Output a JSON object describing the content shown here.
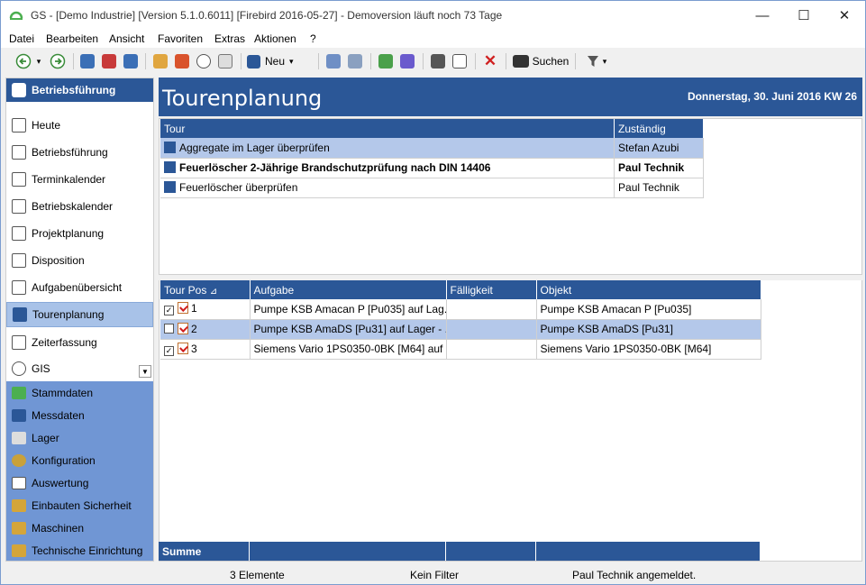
{
  "window": {
    "title": "GS - [Demo Industrie]  [Version  5.1.0.6011]  [Firebird 2016-05-27] - Demoversion läuft noch 73 Tage",
    "minimize": "—",
    "maximize": "☐",
    "close": "✕"
  },
  "menu": [
    "Datei",
    "Bearbeiten",
    "Ansicht",
    "Favoriten",
    "Extras",
    "Aktionen",
    "?"
  ],
  "toolbar": {
    "new_label": "Neu",
    "search_label": "Suchen",
    "dropdown_arrow": "▾"
  },
  "sidebar": {
    "header": "Betriebsführung",
    "items": [
      {
        "label": "Heute",
        "icon": "today-clock-icon"
      },
      {
        "label": "Betriebsführung",
        "icon": "checklist-icon"
      },
      {
        "label": "Terminkalender",
        "icon": "calendar-23-icon"
      },
      {
        "label": "Betriebskalender",
        "icon": "calendar-grid-icon"
      },
      {
        "label": "Projektplanung",
        "icon": "project-plan-icon"
      },
      {
        "label": "Disposition",
        "icon": "disposition-icon"
      },
      {
        "label": "Aufgabenübersicht",
        "icon": "task-overview-icon"
      },
      {
        "label": "Tourenplanung",
        "icon": "road-icon",
        "selected": true
      },
      {
        "label": "Zeiterfassung",
        "icon": "time-tracking-icon"
      },
      {
        "label": "GIS",
        "icon": "globe-icon"
      }
    ],
    "scroll_arrow": "▼",
    "groups": [
      {
        "label": "Stammdaten",
        "icon": "master-data-icon"
      },
      {
        "label": "Messdaten",
        "icon": "measurement-icon"
      },
      {
        "label": "Lager",
        "icon": "warehouse-icon"
      },
      {
        "label": "Konfiguration",
        "icon": "configuration-icon"
      },
      {
        "label": "Auswertung",
        "icon": "report-icon"
      },
      {
        "label": "Einbauten Sicherheit",
        "icon": "folder-icon"
      },
      {
        "label": "Maschinen",
        "icon": "folder-icon"
      },
      {
        "label": "Technische Einrichtung",
        "icon": "folder-icon"
      }
    ]
  },
  "main": {
    "title": "Tourenplanung",
    "date": "Donnerstag, 30. Juni 2016  KW 26",
    "tours": {
      "columns": [
        "Tour",
        "Zuständig"
      ],
      "rows": [
        {
          "tour": "Aggregate im Lager überprüfen",
          "owner": "Stefan Azubi",
          "highlight": true,
          "bold": false
        },
        {
          "tour": "Feuerlöscher 2-Jährige Brandschutzprüfung nach DIN 14406",
          "owner": "Paul Technik",
          "highlight": false,
          "bold": true
        },
        {
          "tour": "Feuerlöscher überprüfen",
          "owner": "Paul Technik",
          "highlight": false,
          "bold": false
        }
      ]
    },
    "tasks": {
      "columns": [
        "Tour Pos",
        "Aufgabe",
        "Fälligkeit",
        "Objekt"
      ],
      "sort_indicator": "⊿",
      "rows": [
        {
          "checked": true,
          "pos": "1",
          "task": "Pumpe KSB Amacan P [Pu035] auf Lag...",
          "due": "",
          "object": "Pumpe KSB Amacan P [Pu035]",
          "highlight": false
        },
        {
          "checked": false,
          "pos": "2",
          "task": "Pumpe KSB AmaDS [Pu31] auf Lager - ...",
          "due": "",
          "object": "Pumpe KSB AmaDS [Pu31]",
          "highlight": true
        },
        {
          "checked": true,
          "pos": "3",
          "task": "Siemens Vario 1PS0350-0BK [M64] auf ...",
          "due": "",
          "object": "Siemens Vario 1PS0350-0BK [M64]",
          "highlight": false
        }
      ],
      "sum_label": "Summe"
    }
  },
  "status": {
    "count": "3 Elemente",
    "filter": "Kein Filter",
    "user": "Paul Technik angemeldet."
  },
  "colors": {
    "accent": "#2b5797",
    "selection": "#b4c8ea",
    "sidebar_groups": "#7096d4"
  }
}
